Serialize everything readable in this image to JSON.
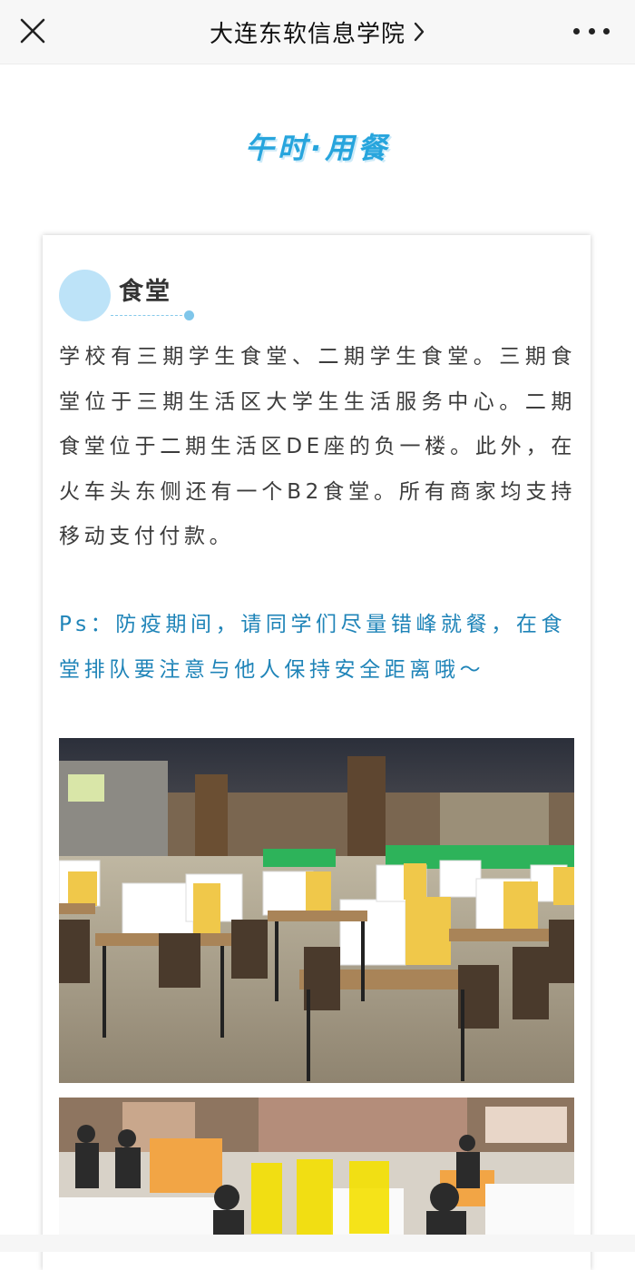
{
  "navbar": {
    "title": "大连东软信息学院",
    "close_icon": "close-icon",
    "chevron_icon": "chevron-right-icon",
    "more_icon": "more-horizontal-icon"
  },
  "section": {
    "heading": "午时·用餐"
  },
  "card": {
    "title": "食堂",
    "body": "学校有三期学生食堂、二期学生食堂。三期食堂位于三期生活区大学生生活服务中心。二期食堂位于二期生活区DE座的负一楼。此外，在火车头东侧还有一个B2食堂。所有商家均支持移动支付付款。",
    "note": "Ps：防疫期间，请同学们尽量错峰就餐，在食堂排队要注意与他人保持安全距离哦～"
  },
  "colors": {
    "accent": "#27a5dd",
    "note_text": "#1f84b8",
    "circle": "#bde3f8"
  }
}
